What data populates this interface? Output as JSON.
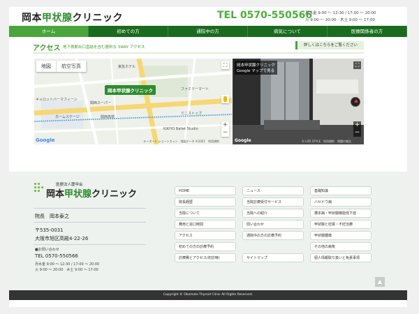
{
  "header": {
    "logo_prefix": "岡本",
    "logo_accent": "甲状腺",
    "logo_suffix": "クリニック",
    "tel": "TEL 0570-550566",
    "hours_line1": "月水金 9:00 ～ 12:30 / 17:00 ～ 20:00",
    "hours_line2": "火 9:00 ～ 20:00　木土 9:00 ～ 17:00"
  },
  "nav": {
    "items": [
      {
        "label": "ホーム"
      },
      {
        "label": "初めての方"
      },
      {
        "label": "通院中の方"
      },
      {
        "label": "病気について"
      },
      {
        "label": "医療関係者の方"
      }
    ]
  },
  "access": {
    "title": "アクセス",
    "subtitle": "地下鉄駅出口直結を含む便利な 3WAY アクセス",
    "more_label": "詳しくはこちらをご覧ください"
  },
  "map": {
    "tab_map": "地図",
    "tab_satellite": "航空写真",
    "pin_label": "岡本甲状腺クリニック",
    "labels": [
      "東急ホテル",
      "関西スーパー",
      "ファミリーマート",
      "キャロットバーマフィーン",
      "ホームステージ",
      "KIKIYO Ballet Studio",
      "関西高校",
      "ミニストップ"
    ],
    "google": "Google",
    "footer": "キーボード ショートカット　地図データ ©2021　利用規約"
  },
  "streetview": {
    "title": "岡本甲状腺クリニック",
    "subtitle": "Google マップで見る",
    "google": "Google",
    "footer": "© LIFE STYLE　利用規約　問題の報告"
  },
  "footer": {
    "logo_sub": "医療法人慶甲会",
    "logo_prefix": "岡本",
    "logo_accent": "甲状腺",
    "logo_suffix": "クリニック",
    "director": "院長　岡本泰之",
    "postal": "〒535-0031",
    "address": "大阪市旭区高殿4-22-26",
    "contact_label": "■お問い合わせ",
    "tel": "TEL 0570-550566",
    "hours_line1": "月水金 9:00 ～ 12:30 / 17:00 ～ 20:00",
    "hours_line2": "火 9:00 ～ 20:00　木土 9:00 ～ 17:00",
    "links": [
      "HOME",
      "ニュース",
      "基礎知識",
      "院長経歴",
      "当院診療受付サービス",
      "バセドウ病",
      "当院について",
      "当院への紹介",
      "橋本病・甲状腺機能低下症",
      "費用と窓口時間",
      "問い合わせ",
      "甲状腺と妊娠・不妊治療",
      "アクセス",
      "通院中の方の診療予約",
      "甲状腺腫瘍",
      "初めての方の診療予約",
      "",
      "その他の病気",
      "診療費とアクセス(初診時)",
      "サイトマップ",
      "個人情報取り扱いと免責事項"
    ],
    "copyright": "Copyright © Okamoto Thyroid Clinic All Rights Reserved."
  },
  "colors": {
    "brand_green": "#1b6b1e",
    "accent_green": "#4aa53c",
    "tel_green": "#4cae3c"
  }
}
